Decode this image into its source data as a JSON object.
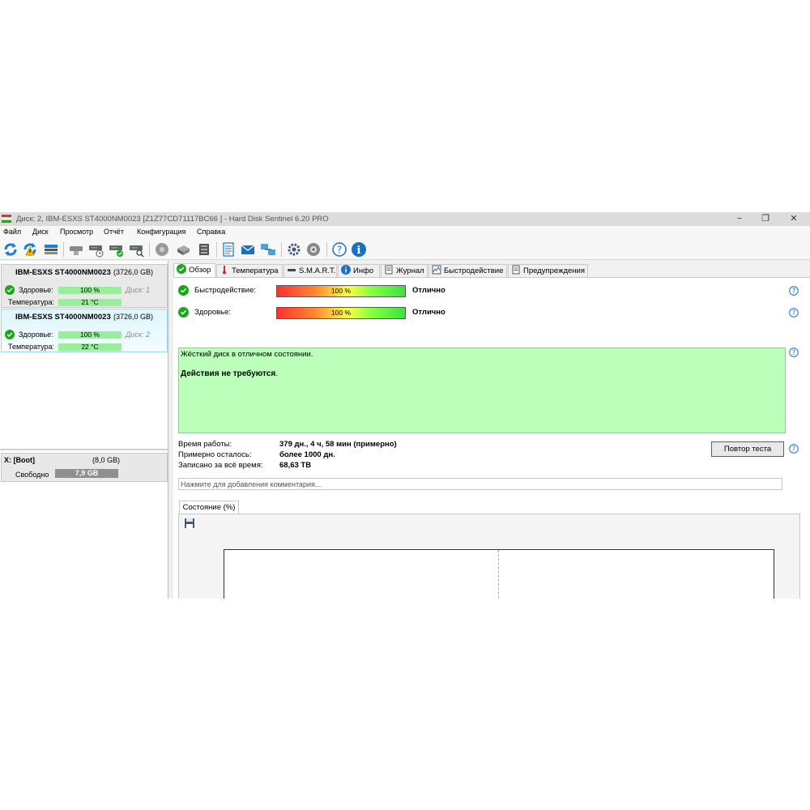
{
  "window": {
    "title": "Диск: 2, IBM-ESXS ST4000NM0023 [Z1Z77CD71117BC66   ]  -  Hard Disk Sentinel 6.20 PRO",
    "minimize": "−",
    "maximize": "❐",
    "close": "✕"
  },
  "menu": [
    "Файл",
    "Диск",
    "Просмотр",
    "Отчёт",
    "Конфигурация",
    "Справка"
  ],
  "toolbar": [
    "refresh-icon",
    "refresh-alert-icon",
    "disk-list-icon",
    "disk-gray-icon",
    "disk-time-icon",
    "disk-check-icon",
    "disk-search-icon",
    "hdd-globe-icon",
    "network-drive-icon",
    "server-icon",
    "report-icon",
    "email-icon",
    "network-icon",
    "settings-icon",
    "sound-icon",
    "help-icon",
    "info-icon"
  ],
  "disks": [
    {
      "name": "IBM-ESXS ST4000NM0023",
      "size": "(3726,0 GB)",
      "health_label": "Здоровье:",
      "health": "100 %",
      "temp_label": "Температура:",
      "temp": "21 °C",
      "disk_num": "Диск: 1"
    },
    {
      "name": "IBM-ESXS ST4000NM0023",
      "size": "(3726,0 GB)",
      "health_label": "Здоровье:",
      "health": "100 %",
      "temp_label": "Температура:",
      "temp": "22 °C",
      "disk_num": "Диск: 2"
    }
  ],
  "volume": {
    "name": "X: [Boot]",
    "size": "(8,0 GB)",
    "free_label": "Свободно",
    "free": "7,9 GB"
  },
  "tabs": [
    "Обзор",
    "Температура",
    "S.M.A.R.T.",
    "Инфо",
    "Журнал",
    "Быстродействие",
    "Предупреждения"
  ],
  "overview": {
    "performance_label": "Быстродействие:",
    "performance_value": "100 %",
    "performance_status": "Отлично",
    "health_label": "Здоровье:",
    "health_value": "100 %",
    "health_status": "Отлично",
    "status_line1": "Жёсткий диск в отличном состоянии.",
    "status_line2": "Действия не требуются",
    "status_dot": ".",
    "uptime_label": "Время работы:",
    "uptime_value": "379 дн., 4 ч, 58 мин (примерно)",
    "remaining_label": "Примерно осталось:",
    "remaining_value": "более 1000 дн.",
    "written_label": "Записано за всё время:",
    "written_value": "68,63 TB",
    "retest_button": "Повтор теста",
    "comment_placeholder": "Нажмите для добавления комментария...",
    "chart_tab": "Состояние (%)"
  },
  "colors": {
    "status_green": "#bbffbb",
    "bar_green": "#99ee99",
    "selected_disk": "#dff6ff",
    "titlebar": "#dcdcdc"
  }
}
